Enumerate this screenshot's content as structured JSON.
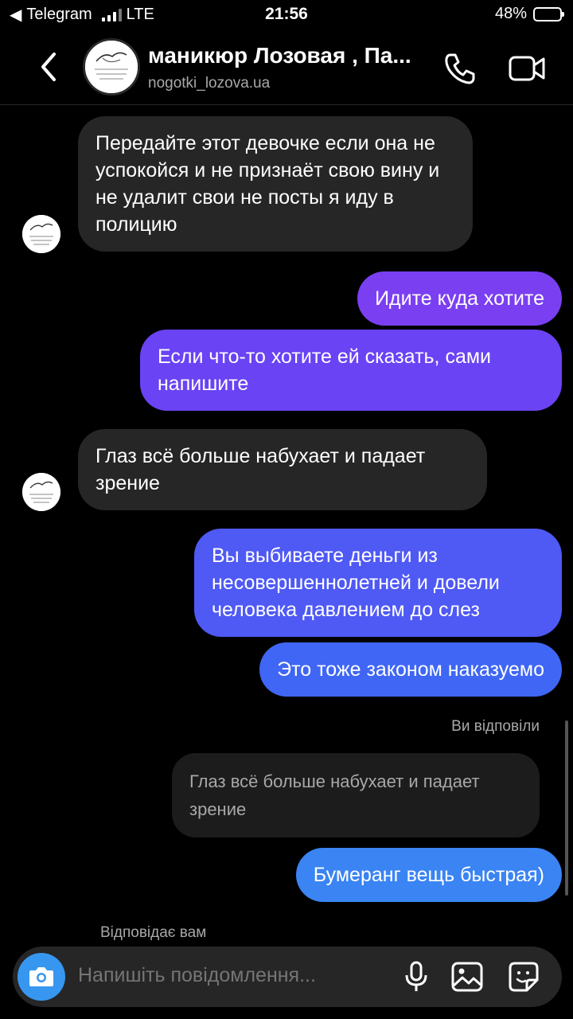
{
  "status_bar": {
    "back_app": "Telegram",
    "network": "LTE",
    "time": "21:56",
    "battery_percent": "48%",
    "battery_level": 0.48
  },
  "header": {
    "title": "маникюр Лозовая , Па...",
    "username": "nogotki_lozova.ua",
    "avatar_icon": "profile-logo-icon"
  },
  "messages": [
    {
      "direction": "in",
      "text": "Передайте этот девочке если она не успокойся и не признаёт свою вину и не удалит свои не посты я иду в полицию"
    },
    {
      "direction": "out",
      "text": "Идите куда хотите",
      "color": "#7b3ff2"
    },
    {
      "direction": "out",
      "text": "Если что-то хотите ей сказать, сами напишите",
      "color": "#6a43f4"
    },
    {
      "direction": "in",
      "text": "Глаз всё больше набухает и падает зрение"
    },
    {
      "direction": "out",
      "text": "Вы выбиваете деньги из несовершеннолетней и довели человека давлением до слез",
      "color": "#4f59f4"
    },
    {
      "direction": "out",
      "text": "Это тоже законом наказуемо",
      "color": "#3f66f5"
    },
    {
      "direction": "out",
      "text": "Бумеранг вещь быстрая)",
      "color": "#3a84f3"
    }
  ],
  "reply": {
    "label": "Ви відповіли",
    "quoted_text": "Глаз всё больше набухает и падает зрение"
  },
  "typing_status": "Відповідає вам",
  "composer": {
    "placeholder": "Напишіть повідомлення..."
  },
  "colors": {
    "background": "#000000",
    "incoming_bubble": "#262626",
    "accent": "#3797f0",
    "secondary_text": "#a8a8a8"
  }
}
